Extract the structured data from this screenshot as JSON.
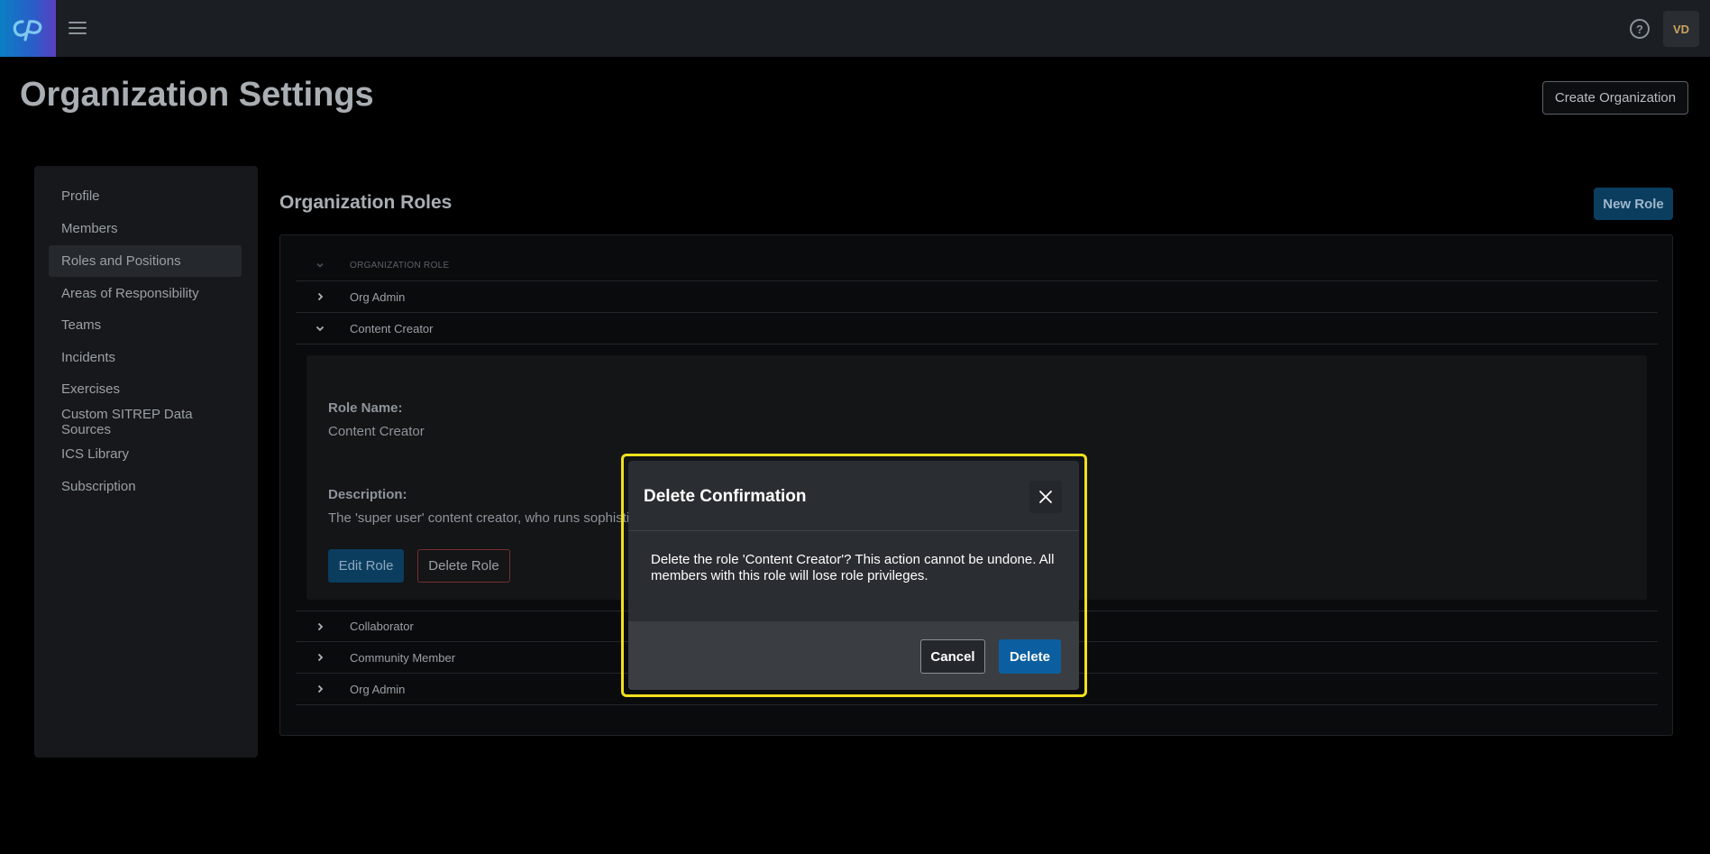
{
  "topbar": {
    "logo_text": "cP",
    "menu_icon": "hamburger-icon",
    "help_icon": "help-circle-icon",
    "avatar_initials": "VD"
  },
  "header": {
    "title": "Organization Settings",
    "create_org_label": "Create Organization"
  },
  "sidebar": {
    "items": [
      {
        "label": "Profile",
        "active": false
      },
      {
        "label": "Members",
        "active": false
      },
      {
        "label": "Roles and Positions",
        "active": true
      },
      {
        "label": "Areas of Responsibility",
        "active": false
      },
      {
        "label": "Teams",
        "active": false
      },
      {
        "label": "Incidents",
        "active": false
      },
      {
        "label": "Exercises",
        "active": false
      },
      {
        "label": "Custom SITREP Data Sources",
        "active": false
      },
      {
        "label": "ICS Library",
        "active": false
      },
      {
        "label": "Subscription",
        "active": false
      }
    ]
  },
  "main": {
    "title": "Organization Roles",
    "new_role_label": "New Role",
    "table": {
      "column_header": "ORGANIZATION ROLE",
      "rows": [
        {
          "label": "Org Admin",
          "expanded": false
        },
        {
          "label": "Content Creator",
          "expanded": true
        },
        {
          "label": "Collaborator",
          "expanded": false
        },
        {
          "label": "Community Member",
          "expanded": false
        },
        {
          "label": "Org Admin",
          "expanded": false
        }
      ]
    },
    "detail": {
      "role_name_label": "Role Name:",
      "role_name_value": "Content Creator",
      "description_label": "Description:",
      "description_value": "The 'super user' content creator, who runs sophistic",
      "edit_label": "Edit Role",
      "delete_label": "Delete Role"
    }
  },
  "modal": {
    "title": "Delete Confirmation",
    "close_icon": "close-icon",
    "body": "Delete the role 'Content Creator'? This action cannot be undone. All members with this role will lose role privileges.",
    "cancel_label": "Cancel",
    "delete_label": "Delete",
    "highlight_color": "#f2e01c"
  },
  "colors": {
    "accent": "#0b5fa0",
    "topbar": "#1b1e23",
    "background": "#000000"
  }
}
